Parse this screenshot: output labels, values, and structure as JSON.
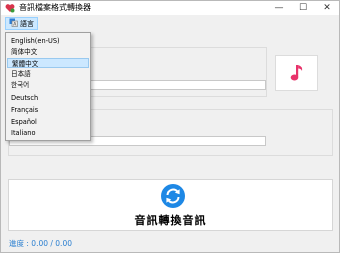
{
  "window": {
    "title": "音訊檔案格式轉換器",
    "controls": {
      "minimize": "—",
      "maximize": "☐",
      "close": "✕"
    }
  },
  "menu": {
    "language_label": "語言",
    "language_icon": "language-icon"
  },
  "language_options": [
    "English(en-US)",
    "简体中文",
    "繁體中文",
    "日本語",
    "한국어",
    "Deutsch",
    "Français",
    "Español",
    "Italiano"
  ],
  "selected_language": "繁體中文",
  "music_button": {
    "icon": "music-note-icon",
    "accent": "#e8336b"
  },
  "convert_button": {
    "label": "音訊轉換音訊",
    "icon": "sync-arrows-icon",
    "accent": "#1e88e5"
  },
  "progress": {
    "text": "進度 : 0.00 / 0.00",
    "color": "#2b7fd0"
  }
}
